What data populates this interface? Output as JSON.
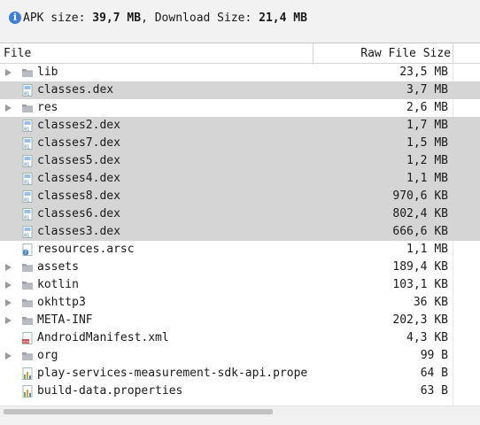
{
  "summary": {
    "label_apk": "APK size: ",
    "apk_size": "39,7 MB",
    "label_download": ", Download Size: ",
    "download_size": "21,4 MB"
  },
  "table": {
    "col_file": "File",
    "col_size": "Raw File Size",
    "rows": [
      {
        "name": "lib",
        "size": "23,5 MB",
        "type": "folder",
        "selected": false
      },
      {
        "name": "classes.dex",
        "size": "3,7 MB",
        "type": "dex",
        "selected": true
      },
      {
        "name": "res",
        "size": "2,6 MB",
        "type": "folder",
        "selected": false
      },
      {
        "name": "classes2.dex",
        "size": "1,7 MB",
        "type": "dex",
        "selected": true
      },
      {
        "name": "classes7.dex",
        "size": "1,5 MB",
        "type": "dex",
        "selected": true
      },
      {
        "name": "classes5.dex",
        "size": "1,2 MB",
        "type": "dex",
        "selected": true
      },
      {
        "name": "classes4.dex",
        "size": "1,1 MB",
        "type": "dex",
        "selected": true
      },
      {
        "name": "classes8.dex",
        "size": "970,6 KB",
        "type": "dex",
        "selected": true
      },
      {
        "name": "classes6.dex",
        "size": "802,4 KB",
        "type": "dex",
        "selected": true
      },
      {
        "name": "classes3.dex",
        "size": "666,6 KB",
        "type": "dex",
        "selected": true
      },
      {
        "name": "resources.arsc",
        "size": "1,1 MB",
        "type": "arsc",
        "selected": false
      },
      {
        "name": "assets",
        "size": "189,4 KB",
        "type": "folder",
        "selected": false
      },
      {
        "name": "kotlin",
        "size": "103,1 KB",
        "type": "folder",
        "selected": false
      },
      {
        "name": "okhttp3",
        "size": "36 KB",
        "type": "folder",
        "selected": false
      },
      {
        "name": "META-INF",
        "size": "202,3 KB",
        "type": "folder",
        "selected": false
      },
      {
        "name": "AndroidManifest.xml",
        "size": "4,3 KB",
        "type": "xml",
        "selected": false
      },
      {
        "name": "org",
        "size": "99 B",
        "type": "folder",
        "selected": false
      },
      {
        "name": "play-services-measurement-sdk-api.prope",
        "size": "64 B",
        "type": "properties",
        "selected": false
      },
      {
        "name": "build-data.properties",
        "size": "63 B",
        "type": "properties",
        "selected": false
      }
    ]
  },
  "icons": {
    "folder": "folder-icon",
    "dex": "dex-file-icon",
    "arsc": "resource-file-icon",
    "xml": "xml-file-icon",
    "properties": "properties-file-icon"
  },
  "colors": {
    "selection": "#d5d5d5",
    "info_icon": "#3d7fd9",
    "dex_icon": "#4a86c5"
  }
}
